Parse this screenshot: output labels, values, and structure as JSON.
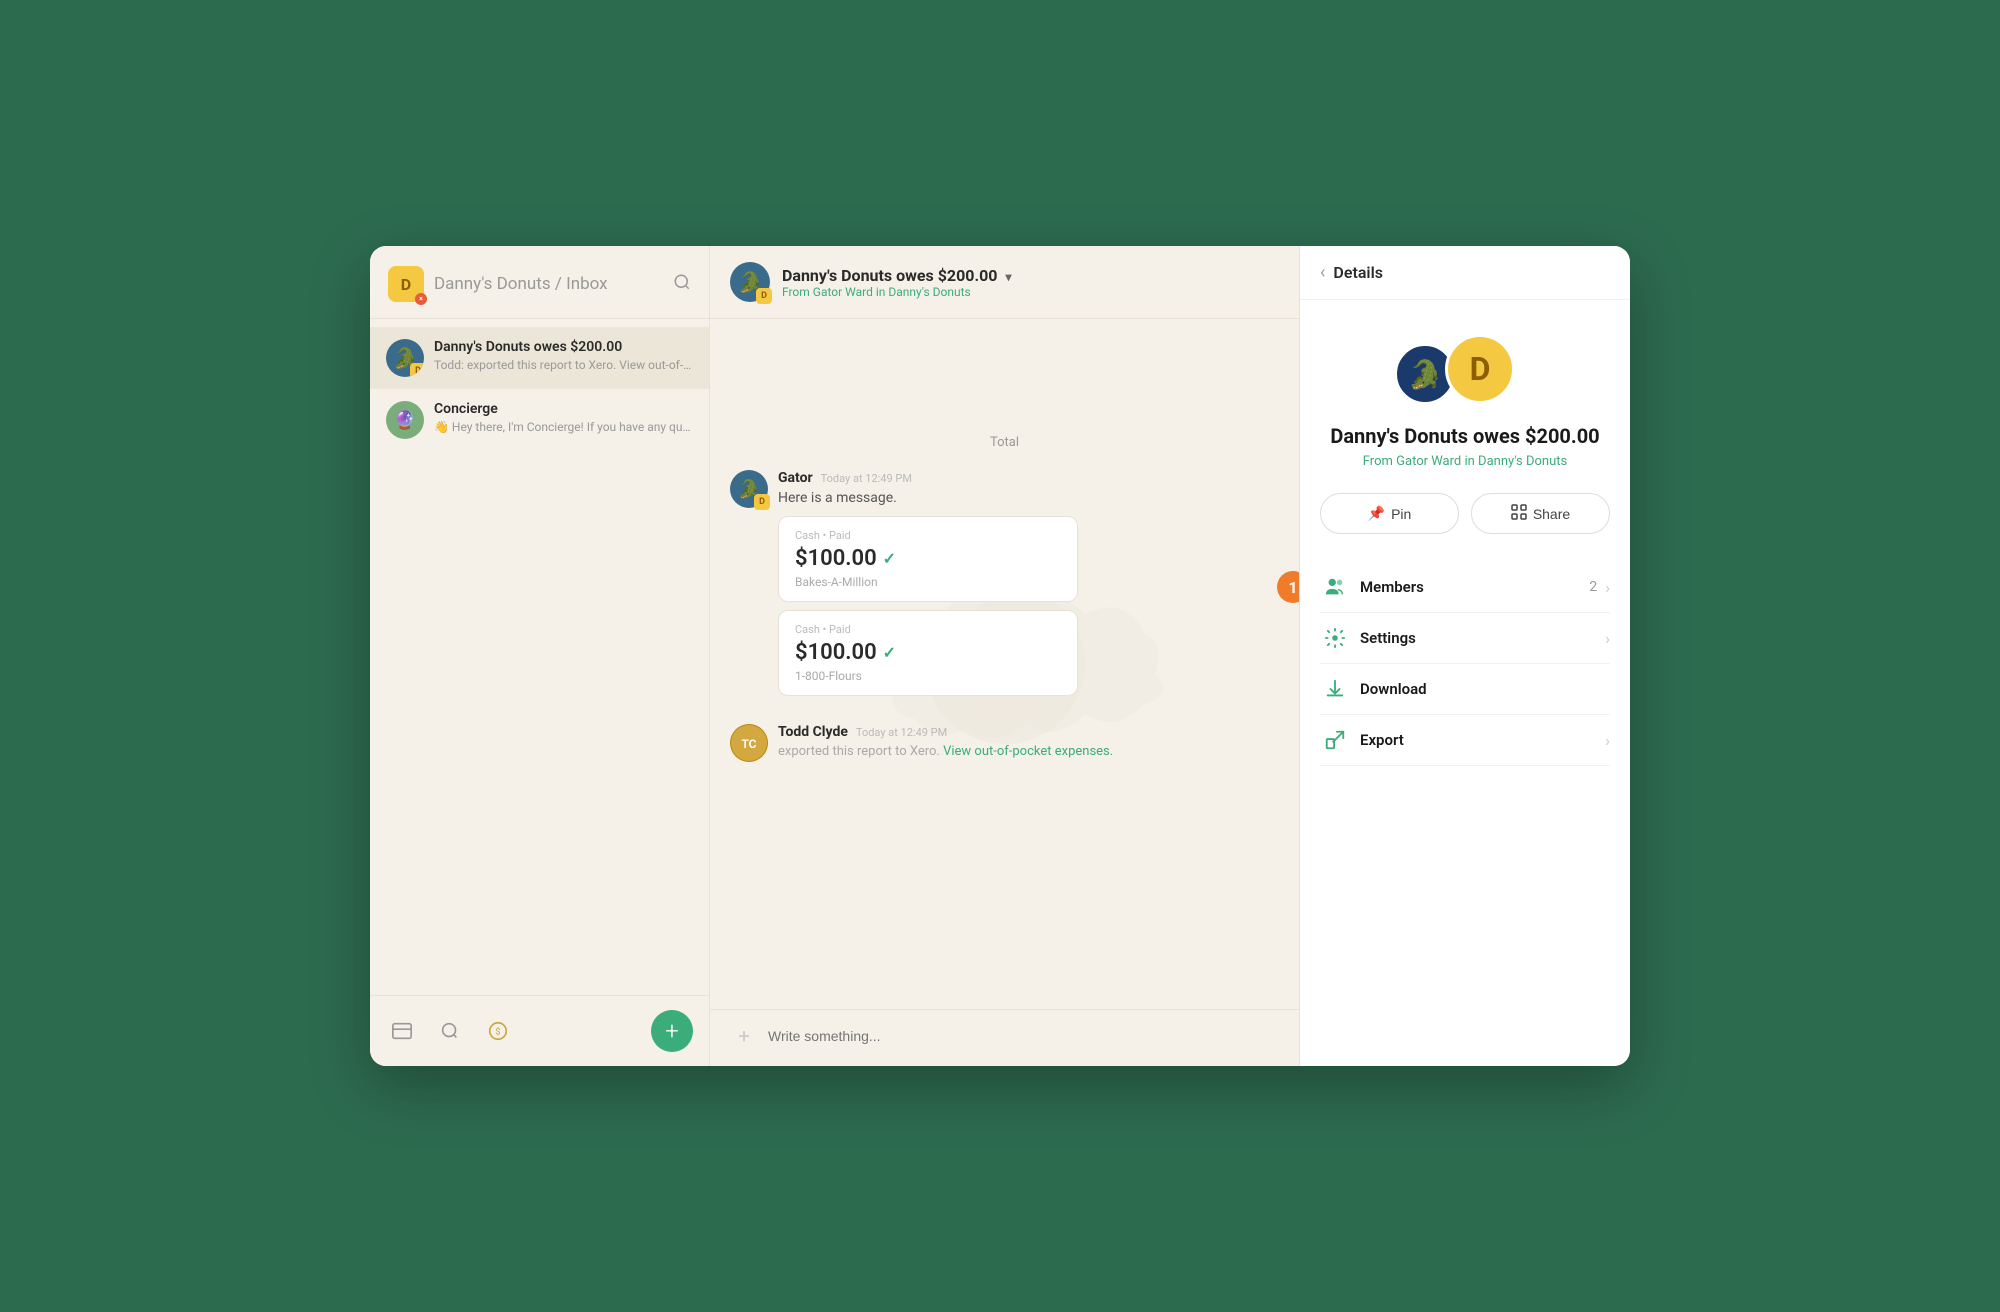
{
  "app": {
    "window_title": "Danny's Donuts Inbox"
  },
  "sidebar": {
    "title": "Danny's Donuts",
    "title_separator": "/",
    "subtitle": "Inbox",
    "avatar_letter": "D",
    "search_label": "Search",
    "items": [
      {
        "id": "dannys-donuts-owes",
        "name": "Danny's Donuts owes $200.00",
        "preview": "Todd: exported this report to Xero. View out-of-p...",
        "avatar_type": "gator"
      },
      {
        "id": "concierge",
        "name": "Concierge",
        "preview": "👋 Hey there, I'm Concierge! If you have any que...",
        "avatar_type": "concierge"
      }
    ],
    "bottom_icons": [
      {
        "id": "inbox-icon",
        "symbol": "💬"
      },
      {
        "id": "search-chat-icon",
        "symbol": "🔍"
      },
      {
        "id": "coin-icon",
        "symbol": "🪙"
      }
    ],
    "add_button_label": "+"
  },
  "chat": {
    "header": {
      "title": "Danny's Donuts owes $200.00",
      "from_label": "From",
      "from_name": "Gator Ward",
      "in_text": "in Danny's Donuts"
    },
    "total_label": "Total",
    "messages": [
      {
        "id": "msg-gator",
        "sender": "Gator",
        "time": "Today at 12:49 PM",
        "text": "Here is a message.",
        "avatar_type": "gator",
        "expenses": [
          {
            "label": "Cash • Paid",
            "amount": "$100.00",
            "merchant": "Bakes-A-Million"
          },
          {
            "label": "Cash • Paid",
            "amount": "$100.00",
            "merchant": "1-800-Flours"
          }
        ]
      },
      {
        "id": "msg-todd",
        "sender": "Todd Clyde",
        "time": "Today at 12:49 PM",
        "text": "exported this report to Xero.",
        "link_text": "View out-of-pocket expenses.",
        "avatar_type": "todd"
      }
    ],
    "input_placeholder": "Write something..."
  },
  "notification": {
    "count": "1",
    "color": "#f07b2a"
  },
  "details": {
    "back_label": "Details",
    "avatar_gator_emoji": "🐊",
    "avatar_d_letter": "D",
    "title": "Danny's Donuts owes $200.00",
    "from_label": "From",
    "from_name": "Gator Ward",
    "in_text": "in Danny's Donuts",
    "actions": [
      {
        "id": "pin",
        "icon": "📌",
        "label": "Pin"
      },
      {
        "id": "share",
        "icon": "⊞",
        "label": "Share"
      }
    ],
    "menu_items": [
      {
        "id": "members",
        "icon": "👥",
        "label": "Members",
        "count": "2",
        "has_chevron": true
      },
      {
        "id": "settings",
        "icon": "⚙️",
        "label": "Settings",
        "count": "",
        "has_chevron": true
      },
      {
        "id": "download",
        "icon": "⬇️",
        "label": "Download",
        "count": "",
        "has_chevron": false
      },
      {
        "id": "export",
        "icon": "↗️",
        "label": "Export",
        "count": "",
        "has_chevron": true
      }
    ]
  }
}
